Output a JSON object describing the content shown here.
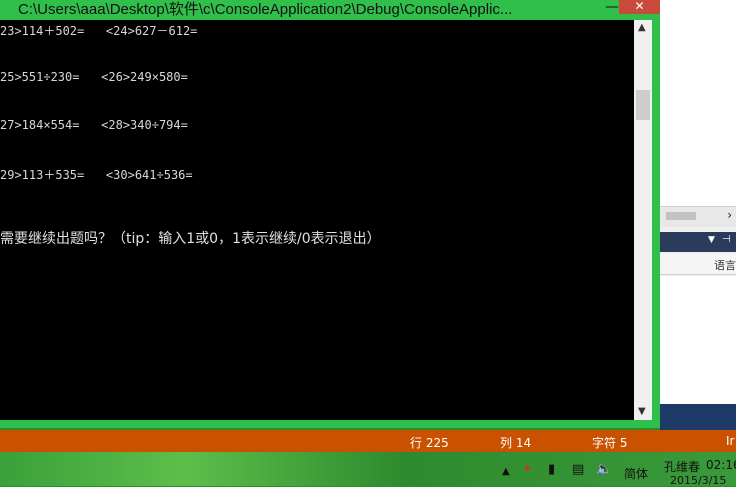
{
  "window": {
    "title": "C:\\Users\\aaa\\Desktop\\软件\\c\\ConsoleApplication2\\Debug\\ConsoleApplic...",
    "minimize_glyph": "—",
    "close_glyph": "✕"
  },
  "console": {
    "lines": [
      "23>114＋502=   <24>627－612=",
      "25>551÷230=   <26>249×580=",
      "27>184×554=   <28>340÷794=",
      "29>113＋535=   <30>641÷536="
    ],
    "prompt": "需要继续出题吗？（tip：输入1或0，1表示继续/0表示退出）"
  },
  "background_panel": {
    "column_label": "语言"
  },
  "status_bar": {
    "row": "行 225",
    "col": "列 14",
    "char": "字符 5",
    "mode": "Ir"
  },
  "taskbar": {
    "ime": "简体",
    "user": "孔维春",
    "time": "02:16",
    "date": "2015/3/15"
  },
  "colors": {
    "window_frame": "#2fbf4a",
    "status_bar": "#ca5100",
    "close_button": "#c74a3b"
  }
}
